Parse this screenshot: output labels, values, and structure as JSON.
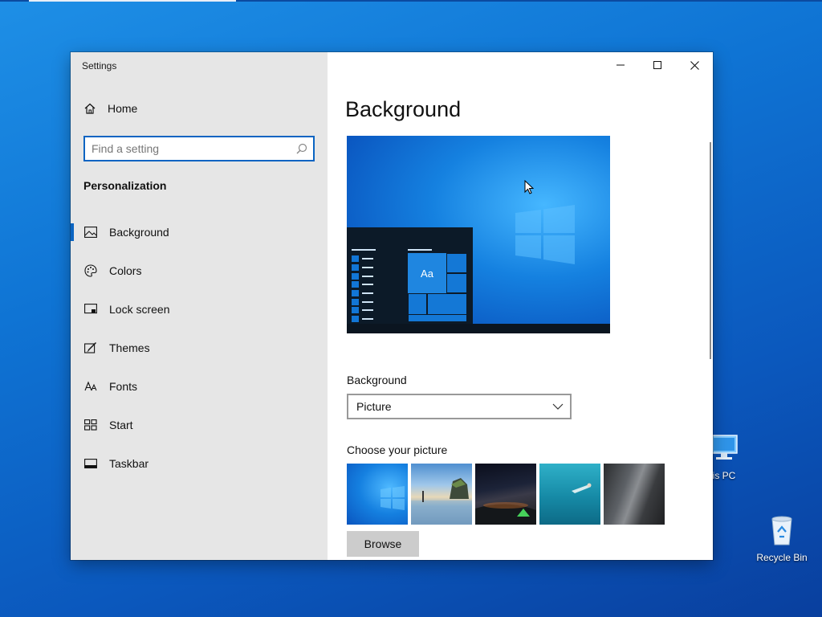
{
  "window": {
    "title": "Settings"
  },
  "sidebar": {
    "home_label": "Home",
    "search_placeholder": "Find a setting",
    "section_title": "Personalization",
    "items": [
      {
        "label": "Background",
        "icon": "picture-icon",
        "active": true
      },
      {
        "label": "Colors",
        "icon": "palette-icon",
        "active": false
      },
      {
        "label": "Lock screen",
        "icon": "lock-screen-icon",
        "active": false
      },
      {
        "label": "Themes",
        "icon": "themes-icon",
        "active": false
      },
      {
        "label": "Fonts",
        "icon": "fonts-icon",
        "active": false
      },
      {
        "label": "Start",
        "icon": "start-icon",
        "active": false
      },
      {
        "label": "Taskbar",
        "icon": "taskbar-icon",
        "active": false
      }
    ]
  },
  "main": {
    "page_title": "Background",
    "preview_tile_text": "Aa",
    "background_label": "Background",
    "background_value": "Picture",
    "choose_picture_label": "Choose your picture",
    "pictures": [
      "windows-hero",
      "beach-rocks",
      "night-sky-tent",
      "underwater-swimmer",
      "rock-cliff"
    ],
    "browse_label": "Browse"
  },
  "desktop": {
    "icons": [
      {
        "label": "is PC",
        "icon": "this-pc-icon"
      },
      {
        "label": "Recycle Bin",
        "icon": "recycle-bin-icon"
      }
    ]
  },
  "colors": {
    "accent": "#0a64c2",
    "sidebar_bg": "#e6e6e6"
  }
}
